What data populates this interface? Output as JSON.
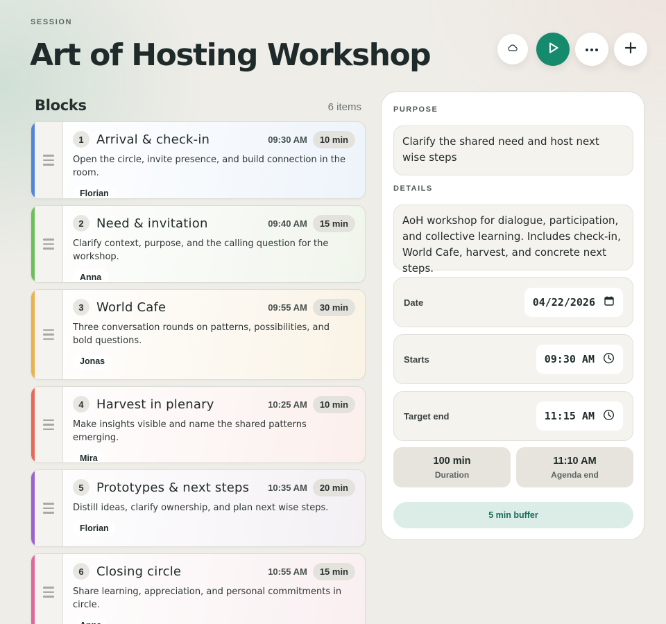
{
  "header": {
    "eyebrow": "SESSION",
    "title": "Art of Hosting Workshop",
    "actions": [
      {
        "icon": "cloud-icon"
      },
      {
        "icon": "play-icon"
      },
      {
        "icon": "more-icon"
      },
      {
        "icon": "plus-icon"
      }
    ]
  },
  "blocks": {
    "title": "Blocks",
    "count": "6 items",
    "items": [
      {
        "num": "1",
        "name": "Arrival & check-in",
        "time": "09:30 AM",
        "duration": "10 min",
        "desc": "Open the circle, invite presence, and build connection in the room.",
        "owner": "Florian",
        "color": "#4f86d9",
        "tint": "#eef4fb"
      },
      {
        "num": "2",
        "name": "Need & invitation",
        "time": "09:40 AM",
        "duration": "15 min",
        "desc": "Clarify context, purpose, and the calling question for the workshop.",
        "owner": "Anna",
        "color": "#6cbf5a",
        "tint": "#f0f5ec"
      },
      {
        "num": "3",
        "name": "World Cafe",
        "time": "09:55 AM",
        "duration": "30 min",
        "desc": "Three conversation rounds on patterns, possibilities, and bold questions.",
        "owner": "Jonas",
        "color": "#e9b24a",
        "tint": "#faf3e6"
      },
      {
        "num": "4",
        "name": "Harvest in plenary",
        "time": "10:25 AM",
        "duration": "10 min",
        "desc": "Make insights visible and name the shared patterns emerging.",
        "owner": "Mira",
        "color": "#e56a5a",
        "tint": "#fbefec"
      },
      {
        "num": "5",
        "name": "Prototypes & next steps",
        "time": "10:35 AM",
        "duration": "20 min",
        "desc": "Distill ideas, clarify ownership, and plan next wise steps.",
        "owner": "Florian",
        "color": "#9a63cf",
        "tint": "#f3f0f4"
      },
      {
        "num": "6",
        "name": "Closing circle",
        "time": "10:55 AM",
        "duration": "15 min",
        "desc": "Share learning, appreciation, and personal commitments in circle.",
        "owner": "Anna",
        "color": "#e0689a",
        "tint": "#f9eff1"
      }
    ]
  },
  "panel": {
    "purpose_label": "PURPOSE",
    "purpose_text": "Clarify the shared need and host next wise steps",
    "details_label": "DETAILS",
    "details_text": "AoH workshop for dialogue, participation, and collective learning. Includes check-in, World Cafe, harvest, and concrete next steps.",
    "date_label": "Date",
    "date_value": "04/22/2026",
    "starts_label": "Starts",
    "starts_value": "09:30 AM",
    "end_label": "Target end",
    "end_value": "11:15 AM",
    "duration_value": "100 min",
    "duration_label": "Duration",
    "agenda_end_value": "11:10 AM",
    "agenda_end_label": "Agenda end",
    "buffer": "5 min buffer"
  },
  "colors": {
    "accent": "#168a6c"
  }
}
